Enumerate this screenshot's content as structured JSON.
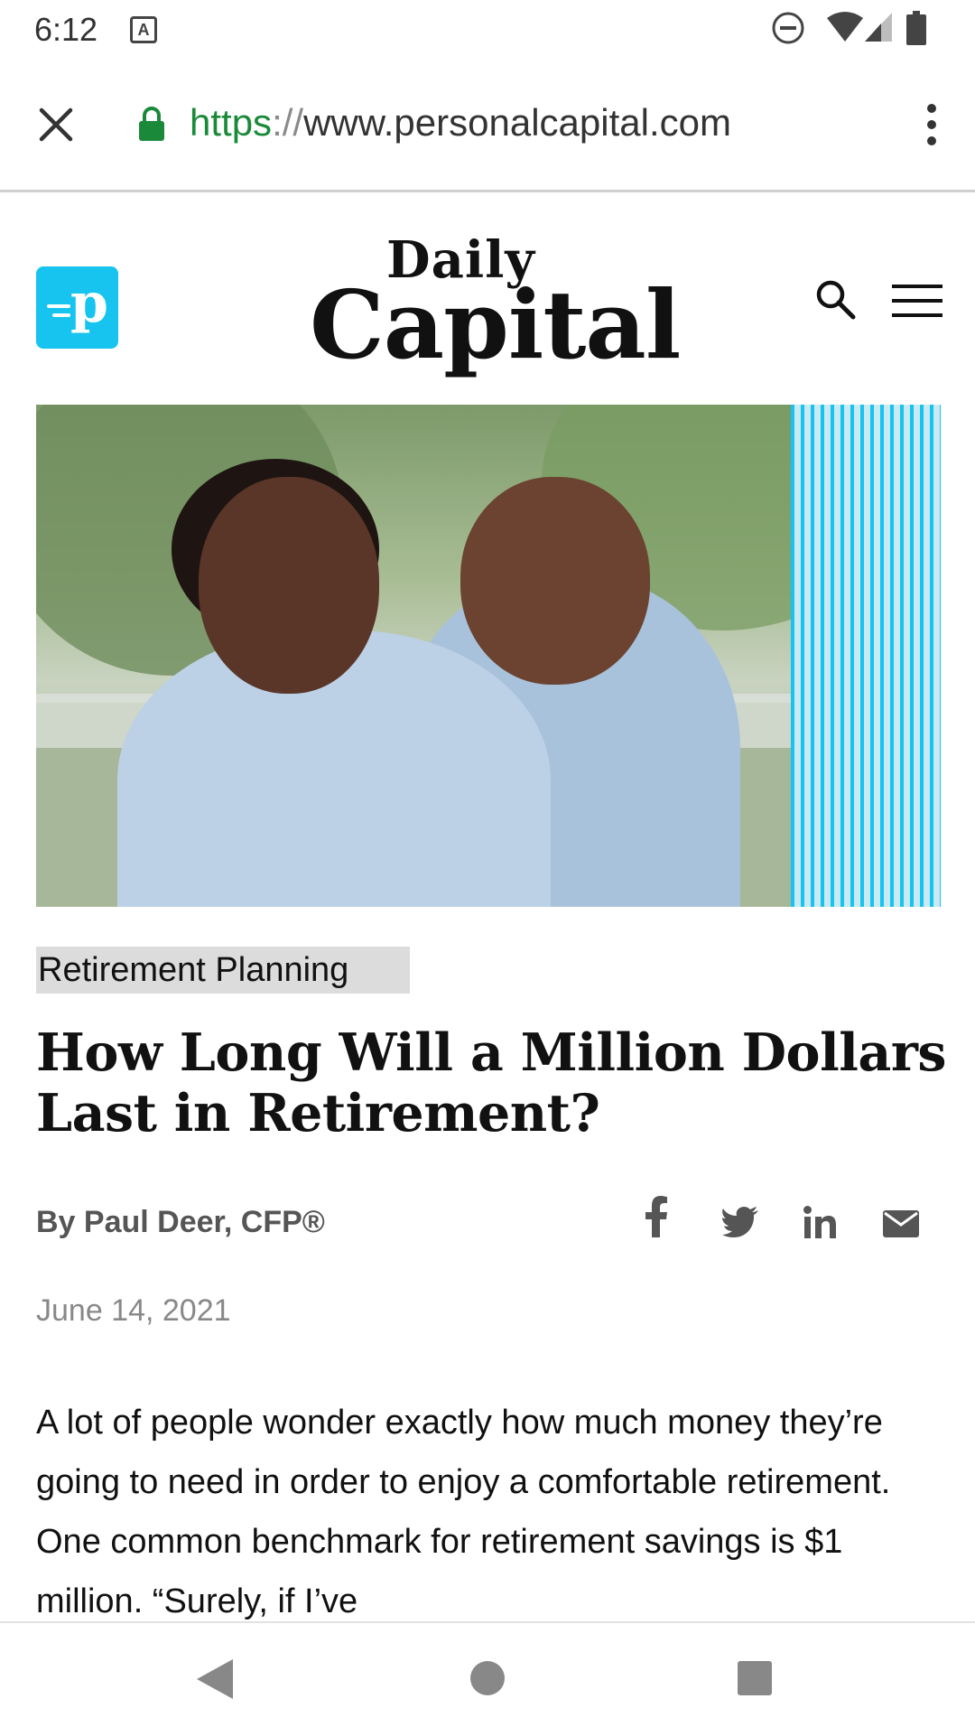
{
  "status_bar": {
    "time": "6:12",
    "notification_icon": "A",
    "icons": [
      "do-not-disturb-icon",
      "wifi-icon",
      "signal-icon",
      "battery-icon"
    ]
  },
  "browser": {
    "url_scheme": "https",
    "url_separator": "://",
    "url_host": "www.personalcapital.com",
    "icons": [
      "close-icon",
      "lock-icon",
      "more-vert-icon"
    ],
    "secure_color": "#1a8a3a"
  },
  "site_header": {
    "logo_letter": "p",
    "brand_small": "Daily",
    "brand_large": "Capital",
    "brand_color": "#16c4ef",
    "icons": [
      "search-icon",
      "hamburger-menu-icon"
    ]
  },
  "article": {
    "category": "Retirement Planning",
    "title": "How Long Will a Million Dollars Last in Retirement?",
    "byline": "By Paul Deer, CFP®",
    "date": "June 14, 2021",
    "share_icons": [
      "facebook-icon",
      "twitter-icon",
      "linkedin-icon",
      "email-icon"
    ],
    "body": "A lot of people wonder exactly how much money they’re going to need in order to enjoy a comfortable retirement. One common benchmark for retirement savings is $1 million. “Surely, if I’ve"
  },
  "nav_bar": {
    "icons": [
      "back-icon",
      "home-icon",
      "recent-apps-icon"
    ]
  }
}
